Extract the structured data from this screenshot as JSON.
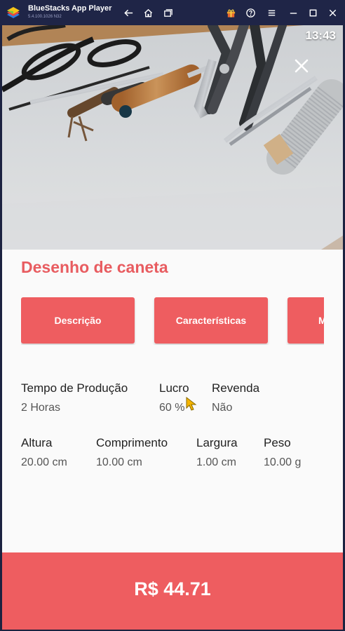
{
  "window": {
    "app_title": "BlueStacks App Player",
    "version": "5.4.100.1026 N32",
    "icons": [
      "back-icon",
      "home-icon",
      "multi-instance-icon",
      "gift-icon",
      "help-icon",
      "menu-icon",
      "minimize-icon",
      "maximize-icon",
      "close-icon"
    ]
  },
  "status": {
    "time": "13:43"
  },
  "product": {
    "title": "Desenho de caneta",
    "tabs": [
      "Descrição",
      "Características",
      "M"
    ],
    "production_time": {
      "label": "Tempo de Produção",
      "value": "2 Horas"
    },
    "profit": {
      "label": "Lucro",
      "value": "60 %"
    },
    "resale": {
      "label": "Revenda",
      "value": "Não"
    },
    "height": {
      "label": "Altura",
      "value": "20.00 cm"
    },
    "length": {
      "label": "Comprimento",
      "value": "10.00 cm"
    },
    "width": {
      "label": "Largura",
      "value": "1.00 cm"
    },
    "weight": {
      "label": "Peso",
      "value": "10.00 g"
    },
    "price": "R$ 44.71"
  },
  "colors": {
    "accent": "#ee5d60",
    "title": "#e85c60",
    "window_bar": "#1f2547"
  }
}
